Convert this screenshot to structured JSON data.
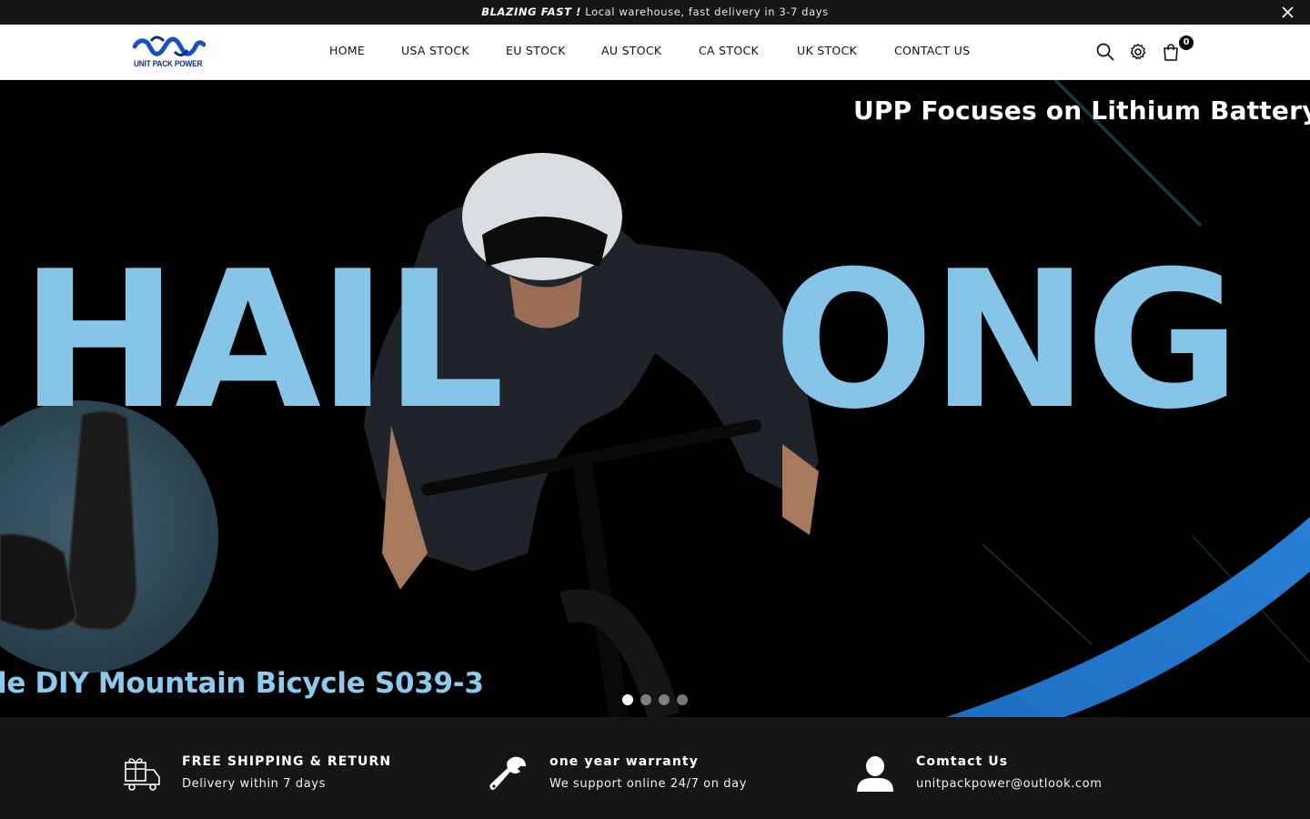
{
  "announcement": {
    "highlight": "BLAZING FAST !",
    "text": "Local warehouse, fast delivery in 3-7 days",
    "close_icon": "close-icon"
  },
  "header": {
    "logo_text": "UNIT PACK POWER",
    "nav": [
      {
        "label": "HOME"
      },
      {
        "label": "USA STOCK"
      },
      {
        "label": "EU STOCK"
      },
      {
        "label": "AU STOCK"
      },
      {
        "label": "CA STOCK"
      },
      {
        "label": "UK STOCK"
      },
      {
        "label": "CONTACT US"
      }
    ],
    "icons": [
      "search-icon",
      "gear-icon",
      "shopping-bag-icon"
    ],
    "cart_count": "0"
  },
  "hero": {
    "headline": "UPP Focuses on Lithium Battery Fie",
    "big_left": "HAIL",
    "big_right": "ONG",
    "product_caption": "le DIY Mountain Bicycle  S039-3",
    "slides": 4,
    "active_slide": 1,
    "accent_color": "#86c5e8"
  },
  "features": [
    {
      "icon": "gift-truck-icon",
      "title": "FREE SHIPPING & RETURN",
      "subtitle": "Delivery within 7 days"
    },
    {
      "icon": "wrench-icon",
      "title": "one year warranty",
      "subtitle": "We support online 24/7 on day"
    },
    {
      "icon": "user-icon",
      "title": "Comtact Us",
      "subtitle": "unitpackpower@outlook.com"
    }
  ]
}
